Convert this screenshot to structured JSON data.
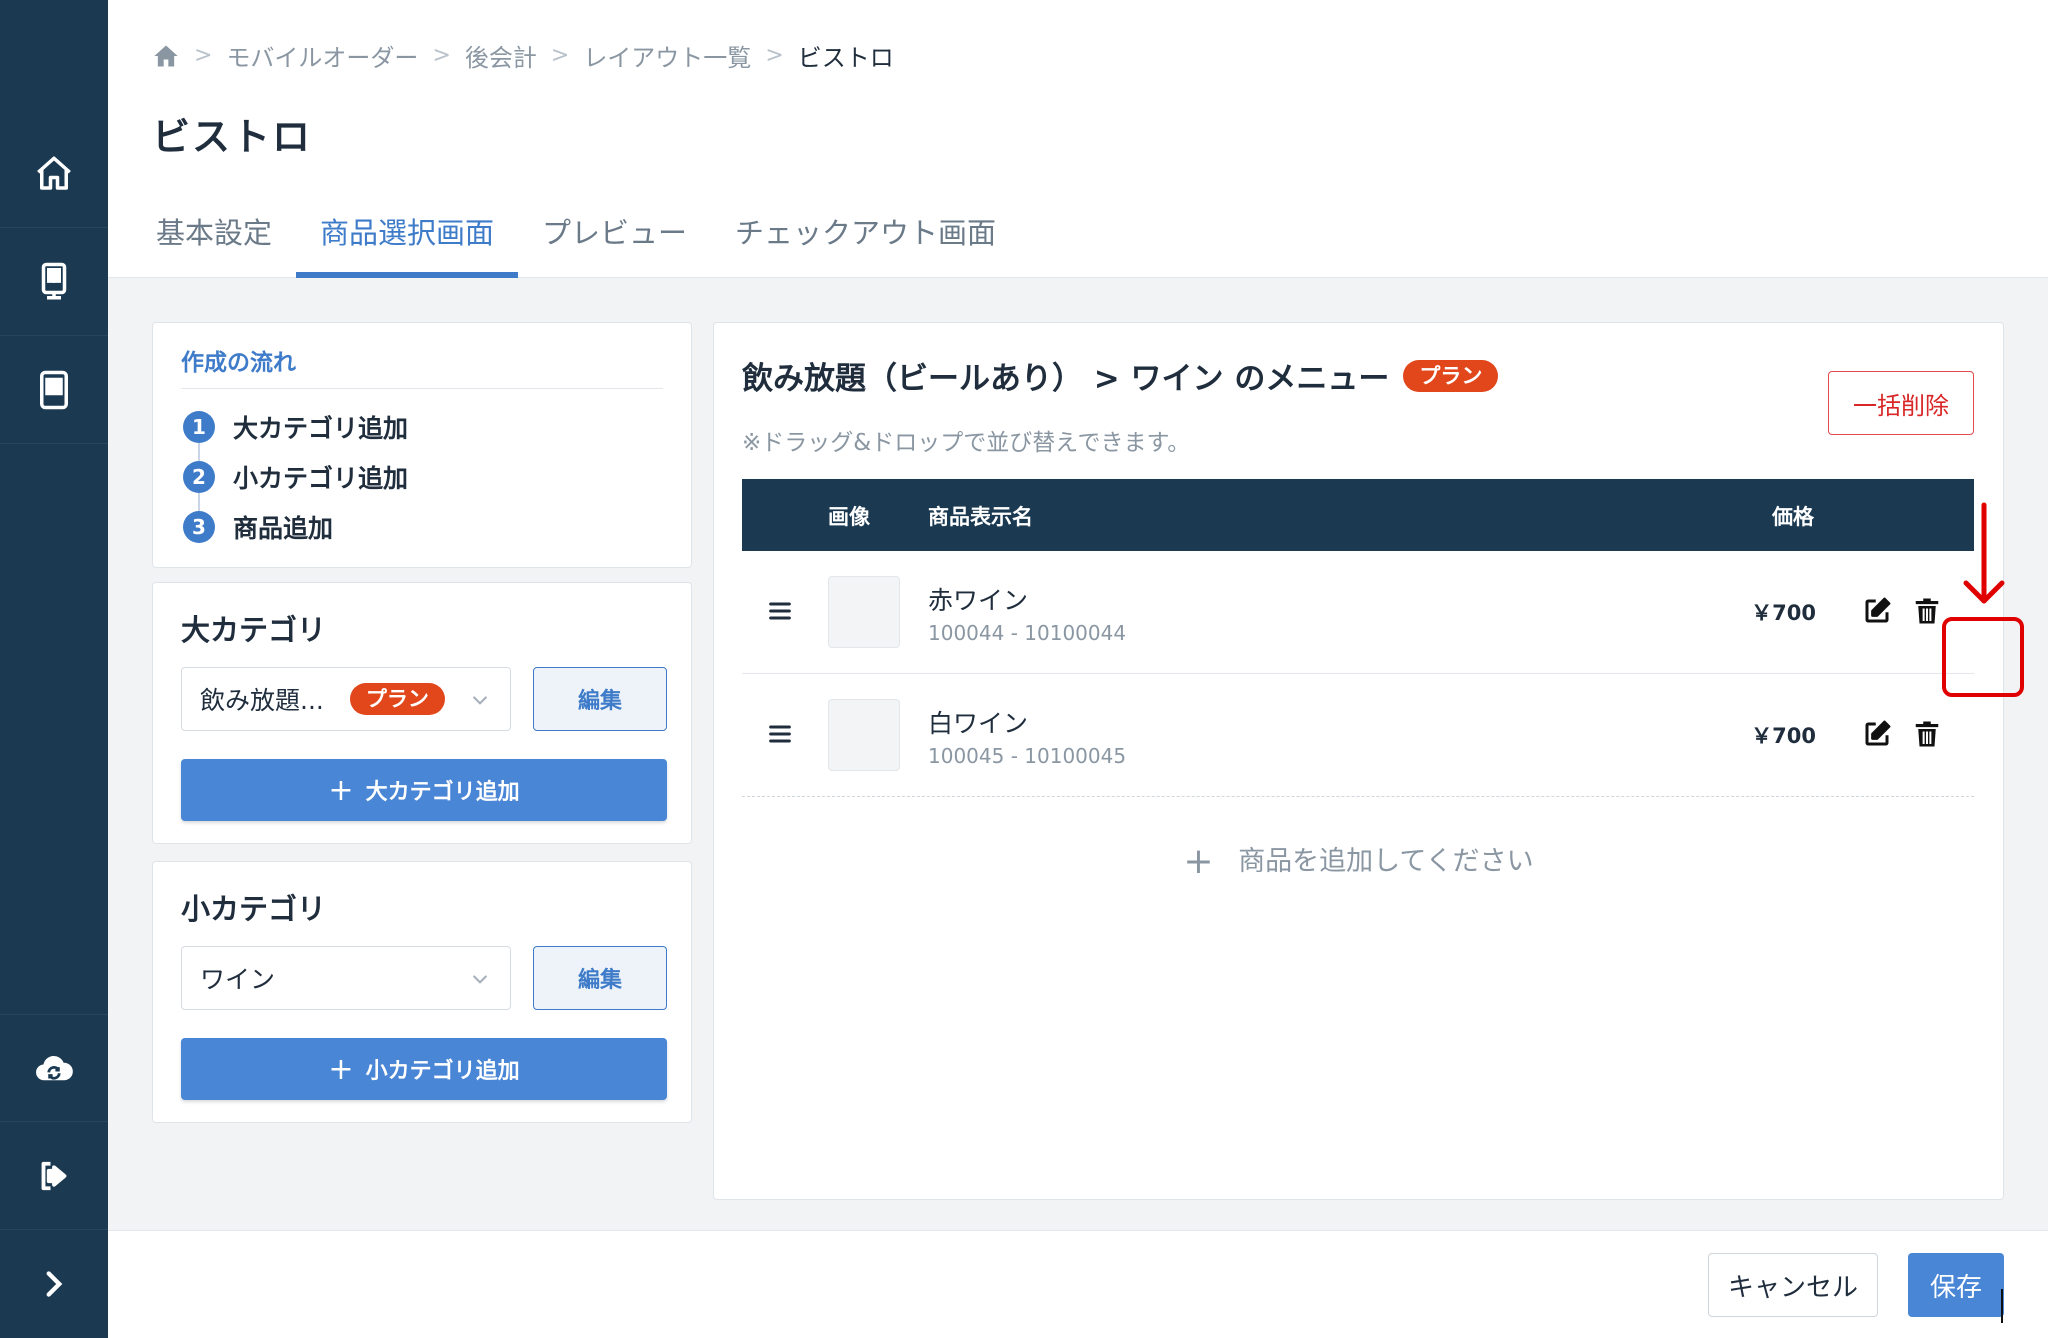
{
  "breadcrumb": {
    "items": [
      "モバイルオーダー",
      "後会計",
      "レイアウト一覧"
    ],
    "current": "ビストロ"
  },
  "page": {
    "title": "ビストロ"
  },
  "tabs": [
    {
      "label": "基本設定",
      "active": false
    },
    {
      "label": "商品選択画面",
      "active": true
    },
    {
      "label": "プレビュー",
      "active": false
    },
    {
      "label": "チェックアウト画面",
      "active": false
    }
  ],
  "flow": {
    "title": "作成の流れ",
    "steps": [
      {
        "num": "1",
        "label": "大カテゴリ追加"
      },
      {
        "num": "2",
        "label": "小カテゴリ追加"
      },
      {
        "num": "3",
        "label": "商品追加"
      }
    ]
  },
  "major_category": {
    "title": "大カテゴリ",
    "selected": "飲み放題...",
    "badge": "プラン",
    "edit_label": "編集",
    "add_label": "大カテゴリ追加"
  },
  "minor_category": {
    "title": "小カテゴリ",
    "selected": "ワイン",
    "edit_label": "編集",
    "add_label": "小カテゴリ追加"
  },
  "menu": {
    "title": "飲み放題（ビールあり） > ワイン のメニュー",
    "badge": "プラン",
    "hint": "※ドラッグ&ドロップで並び替えできます。",
    "bulk_delete_label": "一括削除",
    "columns": {
      "image": "画像",
      "name": "商品表示名",
      "price": "価格"
    },
    "items": [
      {
        "name": "赤ワイン",
        "code": "100044 - 10100044",
        "price": "￥700"
      },
      {
        "name": "白ワイン",
        "code": "100045 - 10100045",
        "price": "￥700"
      }
    ],
    "add_item_label": "商品を追加してください"
  },
  "footer": {
    "cancel_label": "キャンセル",
    "save_label": "保存"
  },
  "colors": {
    "sidebar": "#1b3a52",
    "accent": "#3e7bc9",
    "primary_button": "#4a86d6",
    "badge": "#e2461b",
    "danger": "#d92626",
    "annotation": "#e00000"
  },
  "icons": {
    "sidebar": [
      "home-icon",
      "kiosk-icon",
      "tablet-icon",
      "cloud-sync-icon",
      "logout-icon",
      "chevron-right-icon"
    ],
    "row_actions": [
      "edit-icon",
      "trash-icon"
    ],
    "drag": "hamburger-icon"
  }
}
